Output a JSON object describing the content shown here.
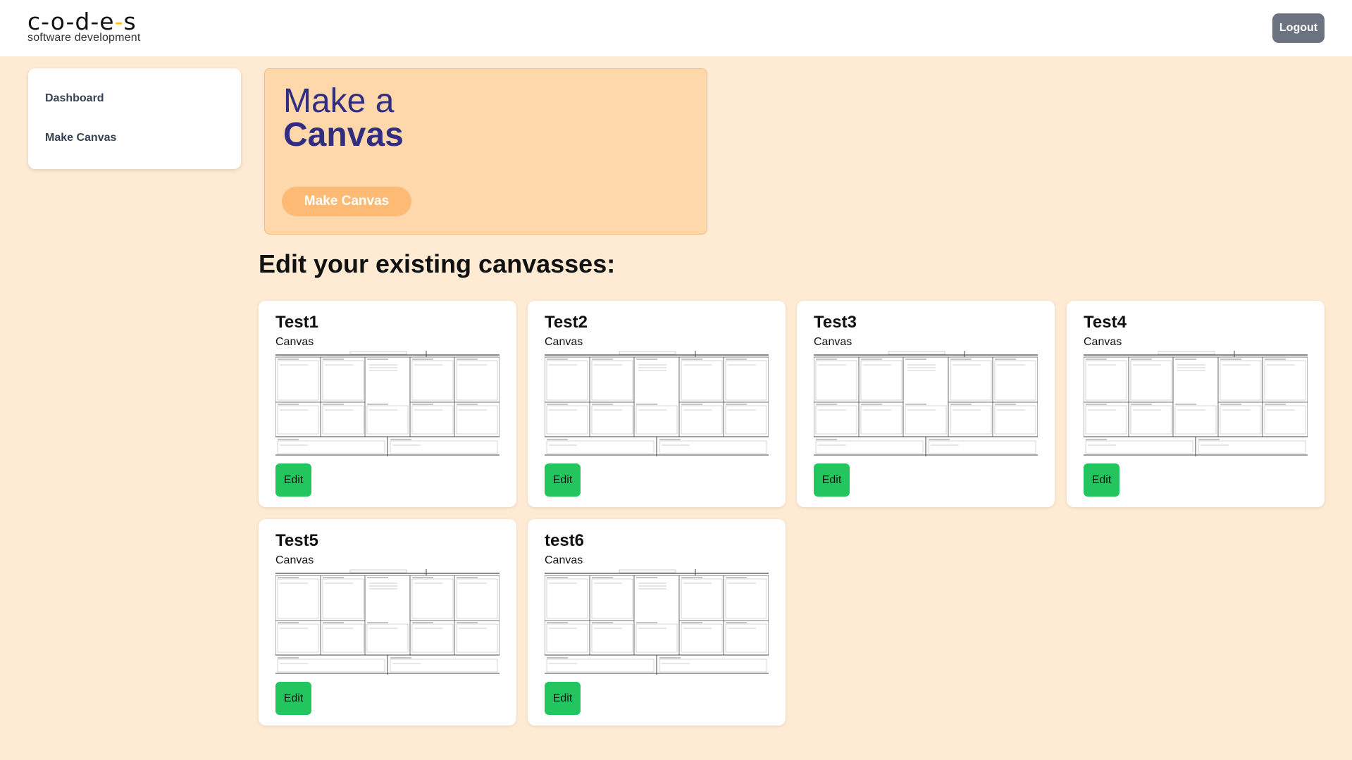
{
  "header": {
    "logo_mark": "c-o-d-e-s",
    "logo_tagline": "software development",
    "logout_label": "Logout"
  },
  "sidebar": {
    "items": [
      {
        "label": "Dashboard"
      },
      {
        "label": "Make Canvas"
      }
    ]
  },
  "hero": {
    "title_line1": "Make a",
    "title_line2": "Canvas",
    "button_label": "Make Canvas"
  },
  "section_title": "Edit your existing canvasses:",
  "canvases": [
    {
      "name": "Test1",
      "type": "Canvas",
      "action": "Edit"
    },
    {
      "name": "Test2",
      "type": "Canvas",
      "action": "Edit"
    },
    {
      "name": "Test3",
      "type": "Canvas",
      "action": "Edit"
    },
    {
      "name": "Test4",
      "type": "Canvas",
      "action": "Edit"
    },
    {
      "name": "Test5",
      "type": "Canvas",
      "action": "Edit"
    },
    {
      "name": "test6",
      "type": "Canvas",
      "action": "Edit"
    }
  ],
  "colors": {
    "page_bg": "#ffebd3",
    "hero_bg": "#fed7aa",
    "hero_button": "#fdba74",
    "hero_title": "#312e81",
    "edit_button": "#22c55e",
    "logout_button": "#6b7280",
    "logo_accent": "#f2c200"
  }
}
